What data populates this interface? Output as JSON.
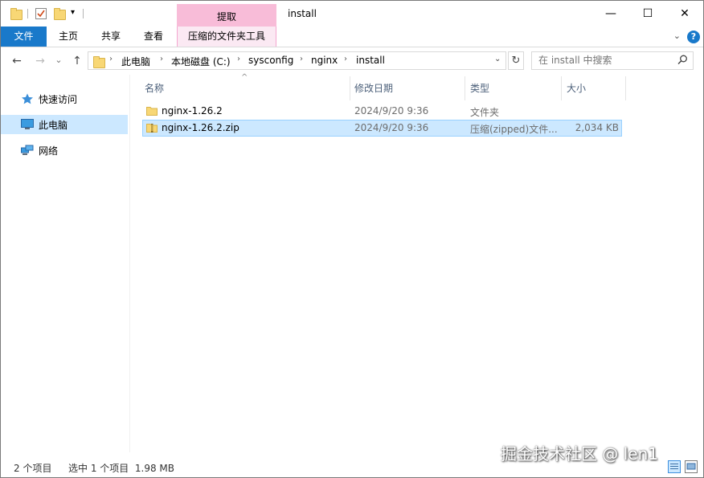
{
  "window": {
    "title": "install"
  },
  "title_bar": {
    "context_tab_title": "提取",
    "minimize": "—",
    "maximize": "☐",
    "close": "✕"
  },
  "ribbon": {
    "tabs": [
      "文件",
      "主页",
      "共享",
      "查看",
      "压缩的文件夹工具"
    ],
    "expand_icon": "chevron-down-icon",
    "help_icon": "?"
  },
  "address": {
    "back": "←",
    "forward": "→",
    "recent": "⌄",
    "up": "↑",
    "breadcrumbs": [
      "此电脑",
      "本地磁盘 (C:)",
      "sysconfig",
      "nginx",
      "install"
    ],
    "search_placeholder": "在 install 中搜索"
  },
  "nav_pane": {
    "items": [
      {
        "label": "快速访问",
        "icon": "star-icon"
      },
      {
        "label": "此电脑",
        "icon": "computer-icon",
        "selected": true
      },
      {
        "label": "网络",
        "icon": "network-icon"
      }
    ]
  },
  "file_list": {
    "columns": [
      "名称",
      "修改日期",
      "类型",
      "大小"
    ],
    "rows": [
      {
        "name": "nginx-1.26.2",
        "date": "2024/9/20 9:36",
        "type": "文件夹",
        "size": "",
        "icon": "folder-icon",
        "selected": false
      },
      {
        "name": "nginx-1.26.2.zip",
        "date": "2024/9/20 9:36",
        "type": "压缩(zipped)文件...",
        "size": "2,034 KB",
        "icon": "zip-folder-icon",
        "selected": true
      }
    ]
  },
  "status_bar": {
    "item_count": "2 个项目",
    "selection": "选中 1 个项目  1.98 MB"
  },
  "watermark": "掘金技术社区 @ len1",
  "colors": {
    "accent": "#1979ca",
    "context_tab": "#f8bcd8",
    "selection": "#cce8ff"
  }
}
